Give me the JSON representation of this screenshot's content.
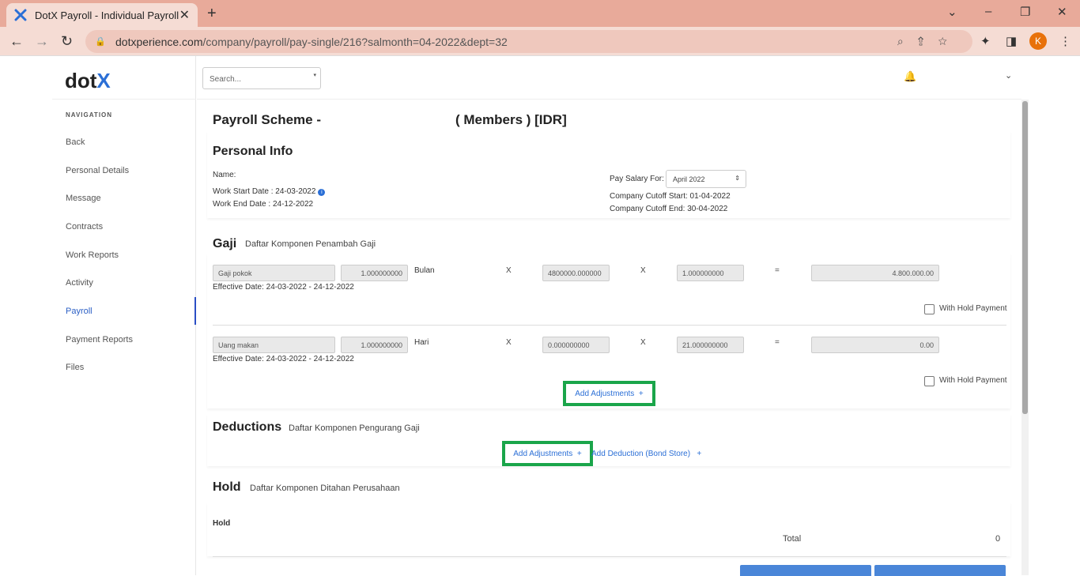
{
  "browser": {
    "tab_title": "DotX Payroll - Individual Payroll",
    "url_domain": "dotxperience.com",
    "url_path": "/company/payroll/pay-single/216?salmonth=04-2022&dept=32",
    "profile_initial": "K"
  },
  "app": {
    "logo_text": "dot",
    "logo_x": "X",
    "search_placeholder": "Search...",
    "nav_heading": "NAVIGATION",
    "nav_items": [
      "Back",
      "Personal Details",
      "Message",
      "Contracts",
      "Work Reports",
      "Activity",
      "Payroll",
      "Payment Reports",
      "Files"
    ],
    "active_nav": "Payroll"
  },
  "header": {
    "title_left": "Payroll Scheme -",
    "title_right": "( Members ) [IDR]"
  },
  "personal_info": {
    "heading": "Personal Info",
    "name_label": "Name:",
    "work_start": "Work Start Date : 24-03-2022",
    "work_end": "Work End Date : 24-12-2022",
    "pay_salary_for_label": "Pay Salary For:",
    "pay_salary_for_value": "April 2022",
    "cutoff_start": "Company Cutoff Start: 01-04-2022",
    "cutoff_end": "Company Cutoff End: 30-04-2022"
  },
  "gaji": {
    "heading": "Gaji",
    "subtitle": "Daftar Komponen Penambah Gaji",
    "rows": [
      {
        "name": "Gaji pokok",
        "qty": "1.000000000",
        "unit": "Bulan",
        "op1": "X",
        "amount": "4800000.000000",
        "op2": "X",
        "factor": "1.000000000",
        "eq": "=",
        "total": "4.800.000.00",
        "effective": "Effective Date: 24-03-2022 - 24-12-2022",
        "hold_label": "With Hold Payment"
      },
      {
        "name": "Uang makan",
        "qty": "1.000000000",
        "unit": "Hari",
        "op1": "X",
        "amount": "0.000000000",
        "op2": "X",
        "factor": "21.000000000",
        "eq": "=",
        "total": "0.00",
        "effective": "Effective Date: 24-03-2022 - 24-12-2022",
        "hold_label": "With Hold Payment"
      }
    ],
    "add_adjustments": "Add Adjustments"
  },
  "deductions": {
    "heading": "Deductions",
    "subtitle": "Daftar Komponen Pengurang Gaji",
    "add_adjustments": "Add Adjustments",
    "add_deduction": "Add Deduction (Bond Store)"
  },
  "hold": {
    "heading": "Hold",
    "subtitle": "Daftar Komponen Ditahan Perusahaan",
    "hold_label": "Hold",
    "total_label": "Total",
    "total_value": "0"
  },
  "icons": {
    "favicon": "dotx-x-icon",
    "colors": {
      "accent": "#2b6fd6",
      "highlight": "#1aa54a",
      "tabbar": "#e8aa9a"
    }
  }
}
